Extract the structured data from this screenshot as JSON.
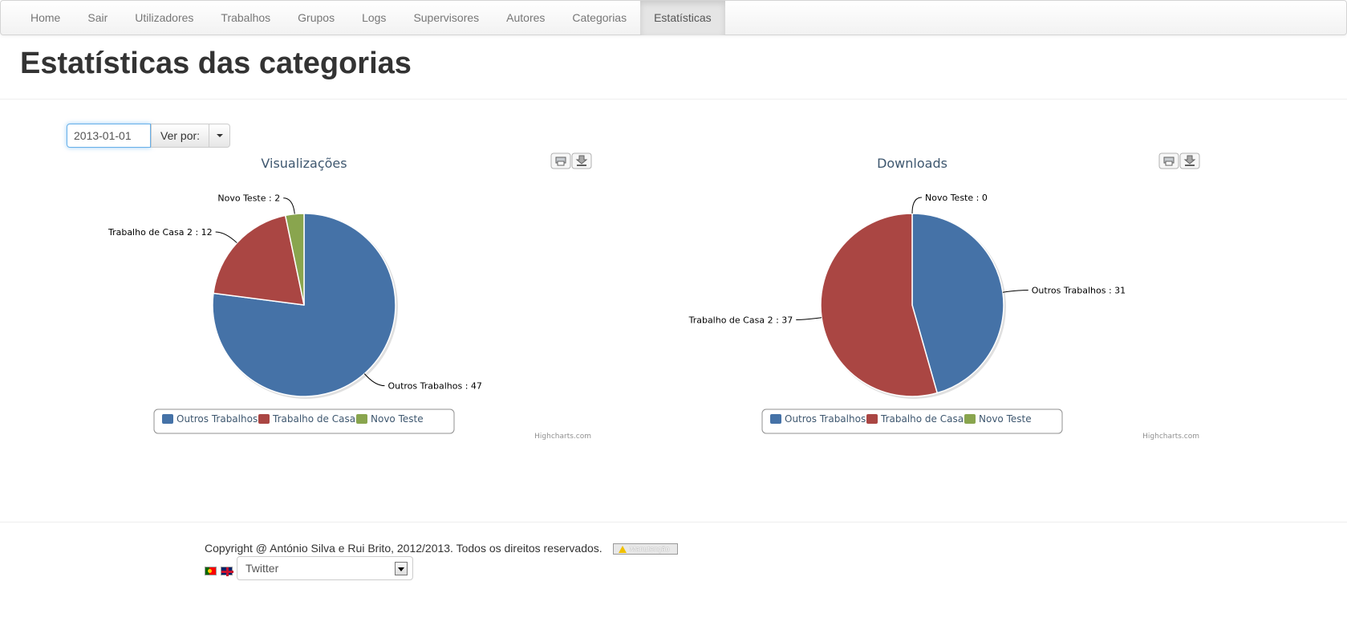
{
  "nav": {
    "items": [
      {
        "label": "Home"
      },
      {
        "label": "Sair"
      },
      {
        "label": "Utilizadores"
      },
      {
        "label": "Trabalhos"
      },
      {
        "label": "Grupos"
      },
      {
        "label": "Logs"
      },
      {
        "label": "Supervisores"
      },
      {
        "label": "Autores"
      },
      {
        "label": "Categorias"
      },
      {
        "label": "Estatísticas",
        "active": true
      }
    ]
  },
  "page": {
    "title": "Estatísticas das categorias"
  },
  "filter": {
    "date_value": "2013-01-01",
    "view_by_label": "Ver por:"
  },
  "chart_data": [
    {
      "type": "pie",
      "title": "Visualizações",
      "categories": [
        "Outros Trabalhos",
        "Trabalho de Casa 2",
        "Novo Teste"
      ],
      "values": [
        47,
        12,
        2
      ],
      "colors": [
        "#4572a7",
        "#aa4643",
        "#89a54e"
      ],
      "data_labels": [
        "Outros Trabalhos   : 47",
        "Trabalho de Casa 2   : 12",
        "Novo Teste   : 2"
      ],
      "legend": "bottom-center",
      "credits": "Highcharts.com"
    },
    {
      "type": "pie",
      "title": "Downloads",
      "categories": [
        "Outros Trabalhos",
        "Trabalho de Casa 2",
        "Novo Teste"
      ],
      "values": [
        31,
        37,
        0
      ],
      "colors": [
        "#4572a7",
        "#aa4643",
        "#89a54e"
      ],
      "data_labels": [
        "Outros Trabalhos   : 31",
        "Trabalho de Casa 2   : 37",
        "Novo Teste   : 0"
      ],
      "legend": "bottom-center",
      "credits": "Highcharts.com"
    }
  ],
  "footer": {
    "copyright": "Copyright @ António Silva e Rui Brito, 2012/2013. Todos os direitos reservados.",
    "maintenance_badge": "Manutenção",
    "social_select": "Twitter",
    "flags": [
      "portugal-flag-icon",
      "uk-flag-icon"
    ]
  }
}
